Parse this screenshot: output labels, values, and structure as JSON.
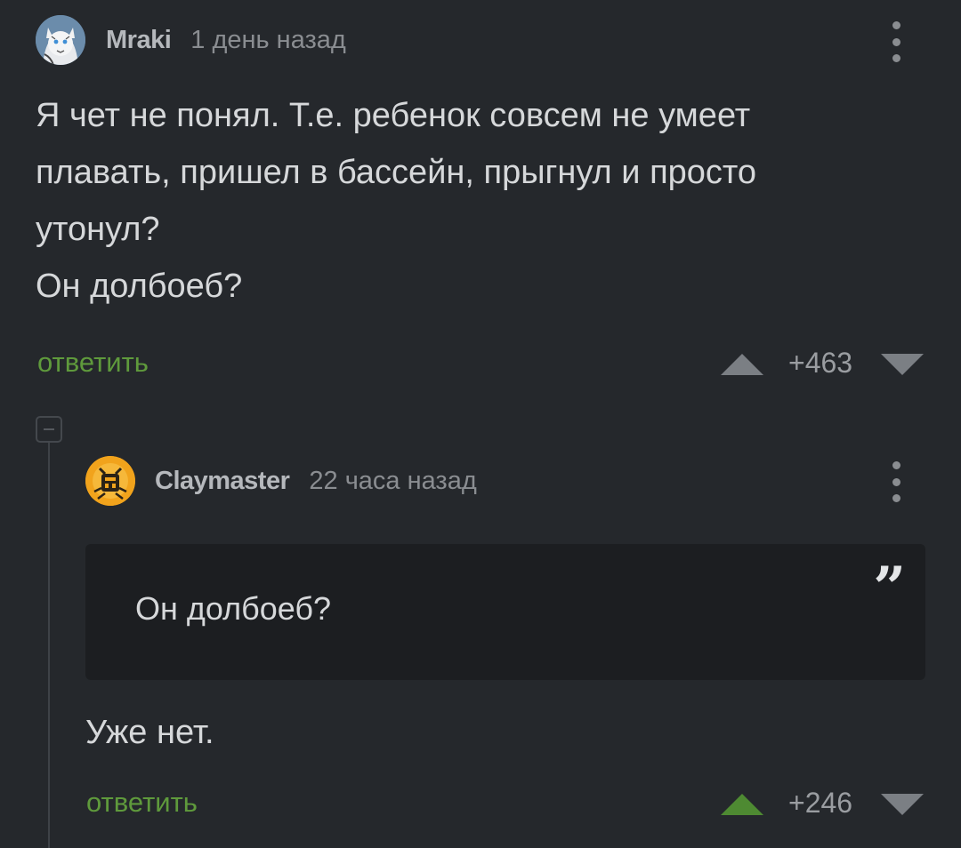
{
  "comment": {
    "username": "Mraki",
    "timestamp": "1 день назад",
    "body_lines": [
      "Я чет не понял. Т.е. ребенок совсем не умеет",
      "плавать, пришел в бассейн, прыгнул  и просто",
      "утонул?",
      "Он долбоеб?"
    ],
    "reply_label": "ответить",
    "rating": "+463",
    "icons": {
      "avatar": "user-avatar-white-tiger",
      "more": "more-vertical-icon",
      "upvote": "arrow-up-icon",
      "downvote": "arrow-down-icon"
    }
  },
  "reply": {
    "username": "Claymaster",
    "timestamp": "22 часа назад",
    "quote": "Он долбоеб?",
    "body": "Уже нет.",
    "reply_label": "ответить",
    "rating": "+246",
    "upvoted": true,
    "icons": {
      "avatar": "user-avatar-orange-emblem",
      "quote": "quote-icon",
      "more": "more-vertical-icon",
      "collapse": "collapse-minus-icon"
    }
  },
  "colors": {
    "background": "#25282c",
    "accent_green": "#5f9a3c",
    "upvote_active": "#4e8a32",
    "vote_inactive": "#7b7f84",
    "quote_background": "#1c1e21"
  }
}
